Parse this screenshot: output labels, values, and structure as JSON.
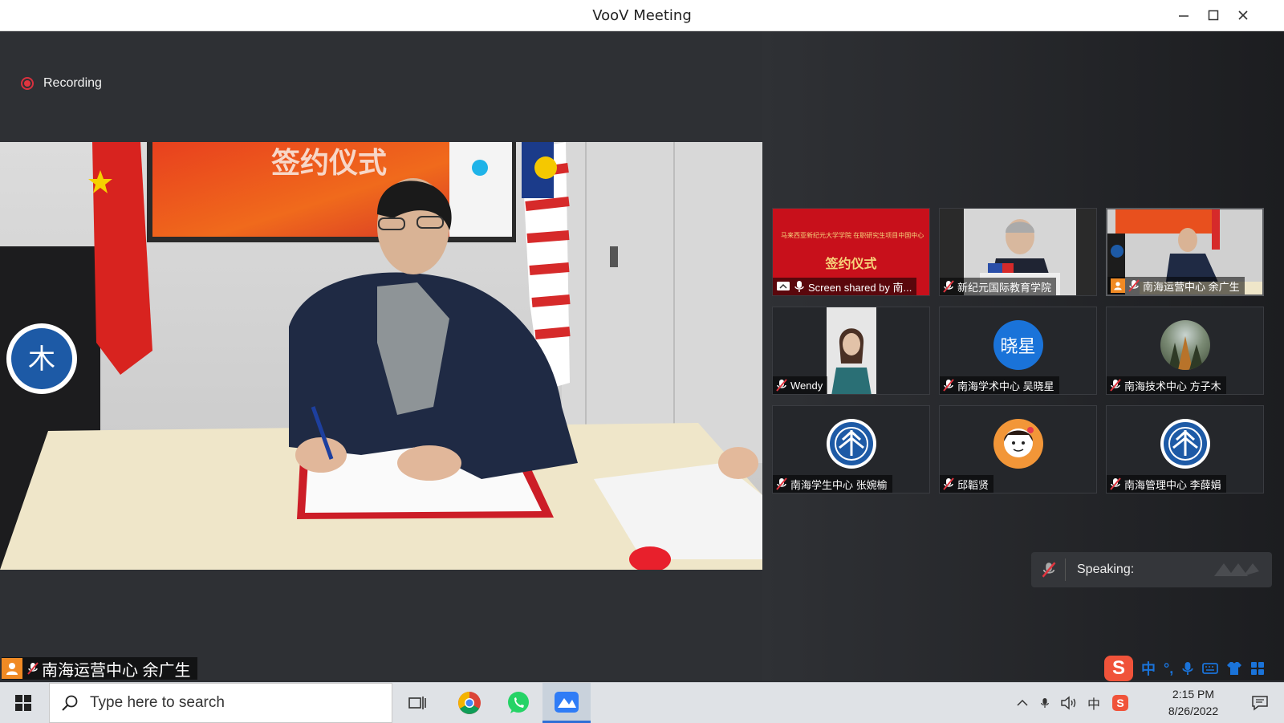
{
  "window": {
    "title": "VooV Meeting"
  },
  "recording": {
    "label": "Recording"
  },
  "main_video": {
    "speaker_name": "南海运营中心 余广生",
    "screen_text": "签约仪式"
  },
  "participants": [
    {
      "name": "Screen shared by 南...",
      "thumb_title": "签约仪式",
      "thumb_line": "马来西亚新纪元大学学院 在职研究生项目中国中心"
    },
    {
      "name": "新纪元国际教育学院"
    },
    {
      "name": "南海运营中心 余广生"
    },
    {
      "name": "Wendy"
    },
    {
      "name": "南海学术中心 吴晓星",
      "avatar_text": "晓星"
    },
    {
      "name": "南海技术中心 方子木"
    },
    {
      "name": "南海学生中心 张婉榆"
    },
    {
      "name": "邱韜贤"
    },
    {
      "name": "南海管理中心 李薛娟"
    }
  ],
  "speaking": {
    "label": "Speaking:"
  },
  "ime": {
    "mode": "中",
    "punct": "°,"
  },
  "taskbar": {
    "search_placeholder": "Type here to search",
    "ime_indicator": "中",
    "time": "2:15 PM",
    "date": "8/26/2022"
  },
  "colors": {
    "accent": "#1a73d9",
    "record": "#e0353f",
    "person_badge": "#f08a24"
  }
}
